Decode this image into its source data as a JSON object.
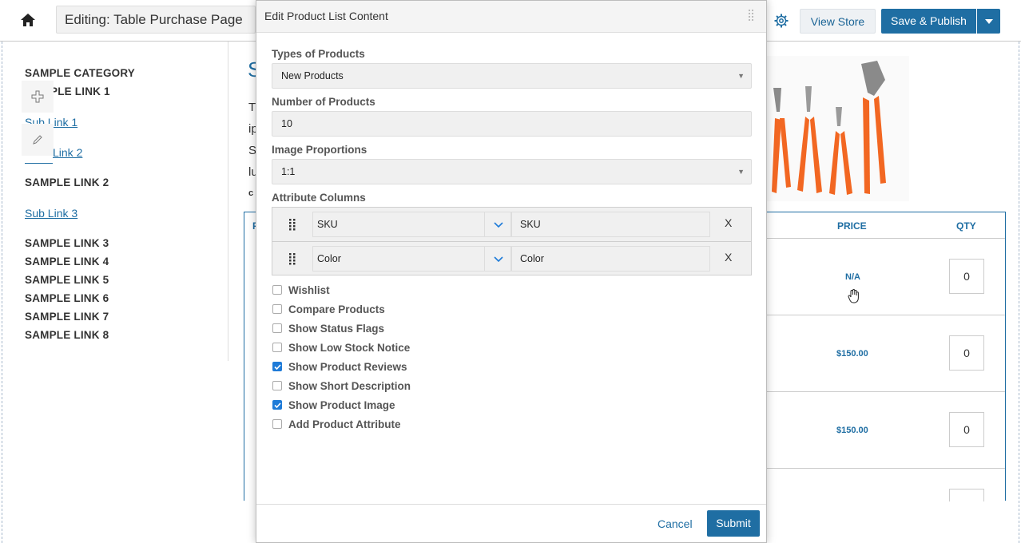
{
  "header": {
    "title": "Editing: Table Purchase Page",
    "view_store": "View Store",
    "save_publish": "Save & Publish"
  },
  "sidebar": {
    "category": "SAMPLE CATEGORY",
    "link1": "PLE LINK 1",
    "sub1": "Sub Link 1",
    "sub2": "Link 2",
    "link2": "SAMPLE LINK 2",
    "sub3": "Sub Link 3",
    "link3": "SAMPLE LINK 3",
    "link4": "SAMPLE LINK 4",
    "link5": "SAMPLE LINK 5",
    "link6": "SAMPLE LINK 6",
    "link7": "SAMPLE LINK 7",
    "link8": "SAMPLE LINK 8"
  },
  "content": {
    "heading": "S",
    "line1": "T",
    "line2": "ip",
    "line3": "S",
    "line4": "lu",
    "line5": "c"
  },
  "table": {
    "col_first": "P",
    "price_header": "PRICE",
    "qty_header": "QTY",
    "rows": [
      {
        "price": "N/A",
        "qty": "0"
      },
      {
        "price": "$150.00",
        "qty": "0"
      },
      {
        "price": "$150.00",
        "qty": "0"
      }
    ]
  },
  "modal": {
    "title": "Edit Product List Content",
    "types_label": "Types of Products",
    "types_value": "New Products",
    "number_label": "Number of Products",
    "number_value": "10",
    "proportions_label": "Image Proportions",
    "proportions_value": "1:1",
    "attr_label": "Attribute Columns",
    "attributes": [
      {
        "field": "SKU",
        "label": "SKU",
        "remove": "X"
      },
      {
        "field": "Color",
        "label": "Color",
        "remove": "X"
      }
    ],
    "options": [
      {
        "label": "Wishlist",
        "checked": false
      },
      {
        "label": "Compare Products",
        "checked": false
      },
      {
        "label": "Show Status Flags",
        "checked": false
      },
      {
        "label": "Show Low Stock Notice",
        "checked": false
      },
      {
        "label": "Show Product Reviews",
        "checked": true
      },
      {
        "label": "Show Short Description",
        "checked": false
      },
      {
        "label": "Show Product Image",
        "checked": true
      },
      {
        "label": "Add Product Attribute",
        "checked": false
      }
    ],
    "cancel": "Cancel",
    "submit": "Submit"
  },
  "colors": {
    "accent": "#1f6ea3",
    "checkbox": "#1e7bd8",
    "pliers_handle": "#f26722"
  }
}
